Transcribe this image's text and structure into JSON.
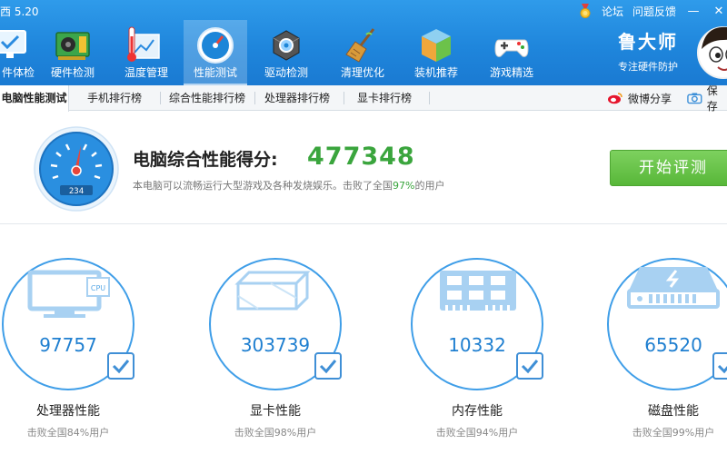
{
  "app": {
    "version": "西 5.20",
    "top_links": {
      "forum": "论坛",
      "feedback": "问题反馈"
    },
    "window_controls": {
      "minimize": "—",
      "close": "✕"
    }
  },
  "toolbar": {
    "items": [
      {
        "label": "件体检",
        "icon": "monitor-check-icon"
      },
      {
        "label": "硬件检测",
        "icon": "hardware-board-icon"
      },
      {
        "label": "温度管理",
        "icon": "thermometer-icon"
      },
      {
        "label": "性能测试",
        "icon": "speed-gauge-icon",
        "active": true
      },
      {
        "label": "驱动检测",
        "icon": "driver-gear-icon"
      },
      {
        "label": "清理优化",
        "icon": "broom-icon"
      },
      {
        "label": "装机推荐",
        "icon": "cube-box-icon"
      },
      {
        "label": "游戏精选",
        "icon": "gamepad-icon"
      }
    ]
  },
  "brand": {
    "name": "鲁大师",
    "slogan": "专注硬件防护"
  },
  "tabs": {
    "items": [
      {
        "label": "电脑性能测试",
        "active": true
      },
      {
        "label": "手机排行榜"
      },
      {
        "label": "综合性能排行榜"
      },
      {
        "label": "处理器排行榜"
      },
      {
        "label": "显卡排行榜"
      }
    ],
    "share_weibo": "微博分享",
    "save_label": "保存"
  },
  "score": {
    "label": "电脑综合性能得分:",
    "value": "477348",
    "gauge_readout": "234",
    "desc_prefix": "本电脑可以流畅运行大型游戏及各种发烧娱乐。击败了全国",
    "desc_percent": "97%",
    "desc_suffix": "的用户",
    "button": "开始评测"
  },
  "components": [
    {
      "title": "处理器性能",
      "value": "97757",
      "beat": "击败全国84%用户",
      "icon": "cpu-monitor-icon",
      "cpu_tag": "CPU"
    },
    {
      "title": "显卡性能",
      "value": "303739",
      "beat": "击败全国98%用户",
      "icon": "graphics-cube-icon"
    },
    {
      "title": "内存性能",
      "value": "10332",
      "beat": "击败全国94%用户",
      "icon": "memory-chip-icon"
    },
    {
      "title": "磁盘性能",
      "value": "65520",
      "beat": "击败全国99%用户",
      "icon": "disk-drive-icon"
    }
  ],
  "colors": {
    "header_blue": "#1f86dc",
    "score_green": "#3aa53d",
    "button_green": "#58b739",
    "ring_blue": "#3f9ee8",
    "value_blue": "#1f7fd0"
  }
}
